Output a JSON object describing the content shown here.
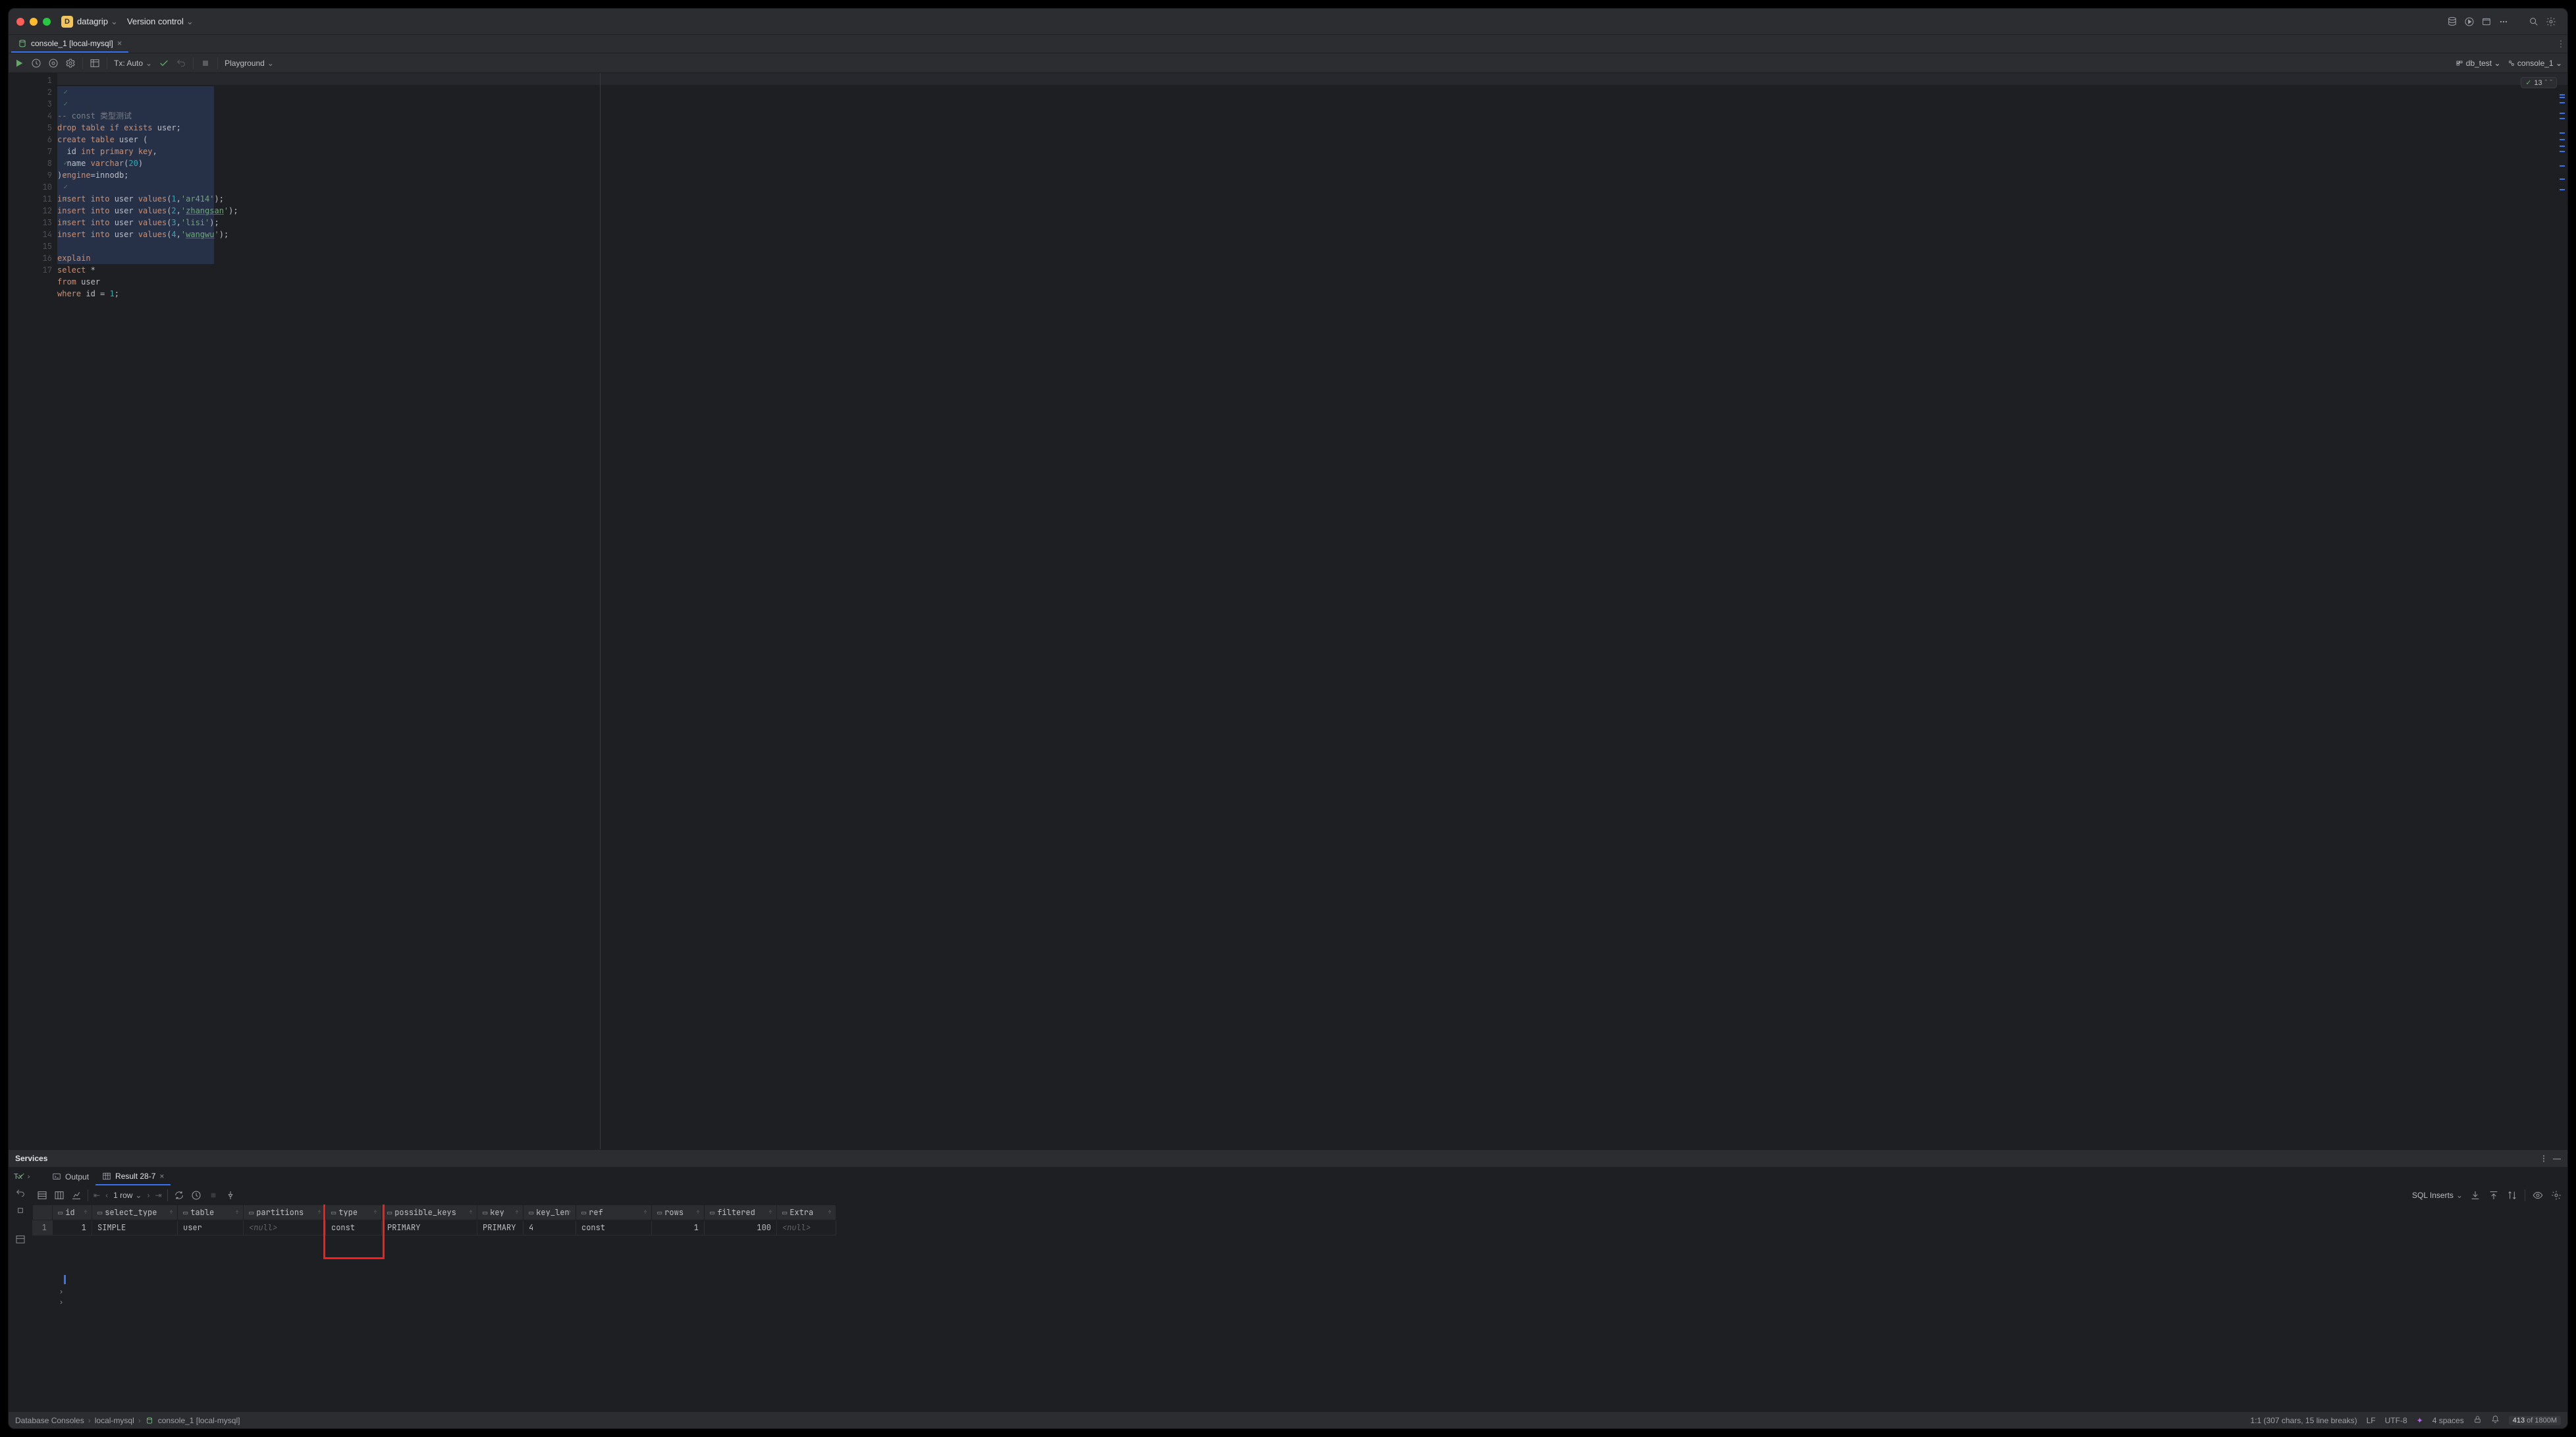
{
  "titlebar": {
    "project": "datagrip",
    "version_control": "Version control"
  },
  "tab": {
    "title": "console_1 [local-mysql]"
  },
  "toolbar": {
    "tx": "Tx: Auto",
    "playground": "Playground",
    "db": "db_test",
    "console": "console_1"
  },
  "editor": {
    "lines": [
      {
        "n": 1,
        "ok": false
      },
      {
        "n": 2,
        "ok": true
      },
      {
        "n": 3,
        "ok": true
      },
      {
        "n": 4,
        "ok": false
      },
      {
        "n": 5,
        "ok": false
      },
      {
        "n": 6,
        "ok": false
      },
      {
        "n": 7,
        "ok": false
      },
      {
        "n": 8,
        "ok": true
      },
      {
        "n": 9,
        "ok": true
      },
      {
        "n": 10,
        "ok": true
      },
      {
        "n": 11,
        "ok": true
      },
      {
        "n": 12,
        "ok": false
      },
      {
        "n": 13,
        "ok": true
      },
      {
        "n": 14,
        "ok": false
      },
      {
        "n": 15,
        "ok": false
      },
      {
        "n": 16,
        "ok": false
      },
      {
        "n": 17,
        "ok": false
      }
    ],
    "problems_count": "13"
  },
  "code": {
    "l1_comment": "-- const 类型测试",
    "l2_a": "drop table if exists ",
    "l2_b": "user",
    "l2_c": ";",
    "l3_a": "create table ",
    "l3_b": "user ",
    "l3_c": "(",
    "l4_a": "  id ",
    "l4_b": "int primary key",
    "l4_c": ",",
    "l5_a": "  name ",
    "l5_b": "varchar",
    "l5_c": "(",
    "l5_d": "20",
    "l5_e": ")",
    "l6_a": ")",
    "l6_b": "engine",
    "l6_c": "=innodb;",
    "l8_a": "insert into ",
    "l8_b": "user ",
    "l8_c": "values",
    "l8_d": "(",
    "l8_e": "1",
    "l8_f": ",",
    "l8_g": "'ar414'",
    "l8_h": ");",
    "l9_a": "insert into ",
    "l9_b": "user ",
    "l9_c": "values",
    "l9_d": "(",
    "l9_e": "2",
    "l9_f": ",",
    "l9_g": "'",
    "l9_h": "zhangsan",
    "l9_i": "'",
    "l9_j": ");",
    "l10_a": "insert into ",
    "l10_b": "user ",
    "l10_c": "values",
    "l10_d": "(",
    "l10_e": "3",
    "l10_f": ",",
    "l10_g": "'lisi'",
    "l10_h": ");",
    "l11_a": "insert into ",
    "l11_b": "user ",
    "l11_c": "values",
    "l11_d": "(",
    "l11_e": "4",
    "l11_f": ",",
    "l11_g": "'",
    "l11_h": "wangwu",
    "l11_i": "'",
    "l11_j": ");",
    "l13_a": "explain",
    "l14_a": "select ",
    "l14_b": "*",
    "l15_a": "from ",
    "l15_b": "user",
    "l16_a": "where ",
    "l16_b": "id = ",
    "l16_c": "1",
    "l16_d": ";"
  },
  "services": {
    "title": "Services",
    "tx_label": "Tx",
    "output_tab": "Output",
    "result_tab": "Result 28-7",
    "rows_label": "1 row",
    "sql_inserts": "SQL Inserts"
  },
  "columns": [
    "id",
    "select_type",
    "table",
    "partitions",
    "type",
    "possible_keys",
    "key",
    "key_len",
    "ref",
    "rows",
    "filtered",
    "Extra"
  ],
  "row": {
    "id": "1",
    "select_type": "SIMPLE",
    "table": "user",
    "partitions": "<null>",
    "type": "const",
    "possible_keys": "PRIMARY",
    "key": "PRIMARY",
    "key_len": "4",
    "ref": "const",
    "rows": "1",
    "filtered": "100",
    "Extra": "<null>"
  },
  "breadcrumb": {
    "a": "Database Consoles",
    "b": "local-mysql",
    "c": "console_1 [local-mysql]"
  },
  "status": {
    "pos": "1:1 (307 chars, 15 line breaks)",
    "eol": "LF",
    "enc": "UTF-8",
    "indent": "4 spaces",
    "mem_used": "413",
    "mem_of": " of 1800M"
  }
}
